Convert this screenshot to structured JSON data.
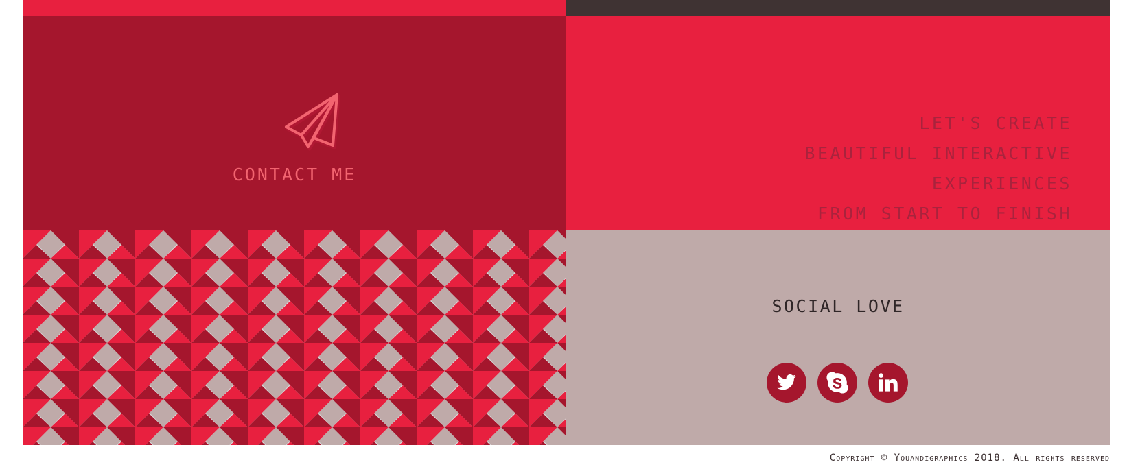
{
  "colors": {
    "accent_red": "#e8203f",
    "dark_red": "#a5162d",
    "dark_brown": "#3f3333",
    "mauve": "#bfaaa9",
    "light_grey": "#d9d7d8",
    "pink": "#f26470"
  },
  "contact": {
    "icon": "paper-plane-icon",
    "label": "CONTACT ME"
  },
  "tagline": {
    "lines": [
      "LET'S CREATE",
      "BEAUTIFUL INTERACTIVE",
      "EXPERIENCES",
      "FROM START TO FINISH"
    ]
  },
  "social": {
    "title": "SOCIAL LOVE",
    "links": [
      {
        "icon": "twitter-icon"
      },
      {
        "icon": "skype-icon"
      },
      {
        "icon": "linkedin-icon"
      }
    ]
  },
  "footer": {
    "copyright": "Copyright © Youandigraphics 2018. All rights reserved"
  }
}
